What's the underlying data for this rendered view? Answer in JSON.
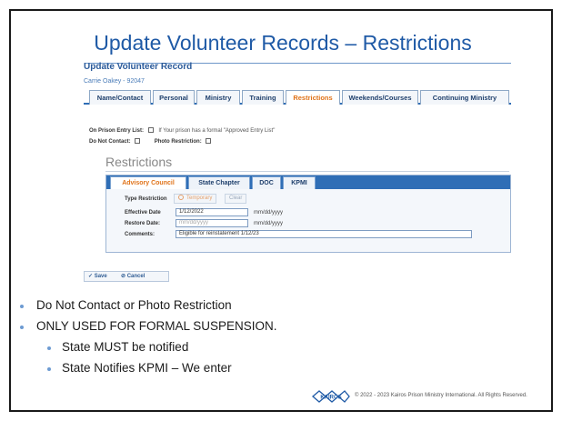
{
  "slide": {
    "title": "Update Volunteer Records – Restrictions",
    "bullets": [
      "Do Not Contact or Photo Restriction",
      "ONLY USED FOR FORMAL SUSPENSION."
    ],
    "sub_bullets": [
      "State MUST be notified",
      "State Notifies KPMI – We enter"
    ],
    "footer": {
      "logo": "KAIROS",
      "copyright": "© 2022 - 2023 Kairos Prison Ministry International. All Rights Reserved."
    }
  },
  "screenshot": {
    "record_title": "Update Volunteer Record",
    "person": "Carrie Oakey - 92047",
    "tabs": [
      "Name/Contact",
      "Personal",
      "Ministry",
      "Training",
      "Restrictions",
      "Weekends/Courses",
      "Continuing Ministry"
    ],
    "active_tab": "Restrictions",
    "on_prison_entry_label": "On Prison Entry List:",
    "on_prison_entry_note": "If Your prison has a formal \"Approved Entry List\"",
    "do_not_contact_label": "Do Not Contact:",
    "photo_restriction_label": "Photo Restriction:",
    "section_heading": "Restrictions",
    "inner_tabs": [
      "Advisory Council",
      "State Chapter",
      "DOC",
      "KPMI"
    ],
    "active_inner_tab": "Advisory Council",
    "type_restriction_label": "Type Restriction",
    "temporary_option": "Temporary",
    "clear_button": "Clear",
    "effective_date_label": "Effective Date",
    "effective_date_value": "1/12/2022",
    "restore_date_label": "Restore Date:",
    "date_placeholder": "mm/dd/yyyy",
    "date_format": "mm/dd/yyyy",
    "comments_label": "Comments:",
    "comments_value": "Eligible for reinstatement 1/12/23",
    "save_label": "Save",
    "cancel_label": "Cancel"
  },
  "colors": {
    "title_blue": "#1f5aa6",
    "tab_active": "#e0731a",
    "accent_blue": "#2f6eb6"
  },
  "icons": {
    "save": "check-icon",
    "cancel": "cancel-icon",
    "bullet": "bullet-dot-icon"
  }
}
